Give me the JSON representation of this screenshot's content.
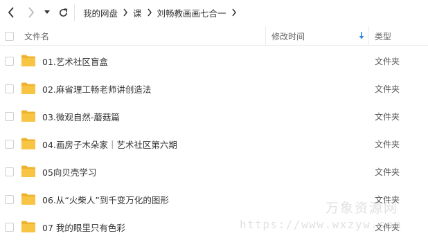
{
  "toolbar": {
    "back_icon": "chevron-left-icon",
    "forward_icon": "chevron-right-icon",
    "dropdown_icon": "caret-down-icon",
    "refresh_icon": "refresh-icon"
  },
  "breadcrumb": [
    "我的网盘",
    "课",
    "刘畅教画画七合一"
  ],
  "columns": {
    "name": "文件名",
    "modified": "修改时间",
    "type": "类型"
  },
  "files": [
    {
      "name": "01.艺术社区盲盒",
      "type": "文件夹"
    },
    {
      "name": "02.麻省理工畅老师讲创造法",
      "type": "文件夹"
    },
    {
      "name": "03.微观自然-蘑菇篇",
      "type": "文件夹"
    },
    {
      "name": "04.画房子木朵家｜艺术社区第六期",
      "type": "文件夹"
    },
    {
      "name": "05向贝壳学习",
      "type": "文件夹"
    },
    {
      "name": "06.从“火柴人”到千变万化的图形",
      "type": "文件夹"
    },
    {
      "name": "07 我的眼里只有色彩",
      "type": "文件夹"
    }
  ],
  "watermark": {
    "line1": "万象资源网",
    "line2": "https://www.wxzyw.com"
  },
  "colors": {
    "folder": "#f7c543",
    "folder_dark": "#eeb32c",
    "sort_arrow": "#2b8ae6"
  }
}
